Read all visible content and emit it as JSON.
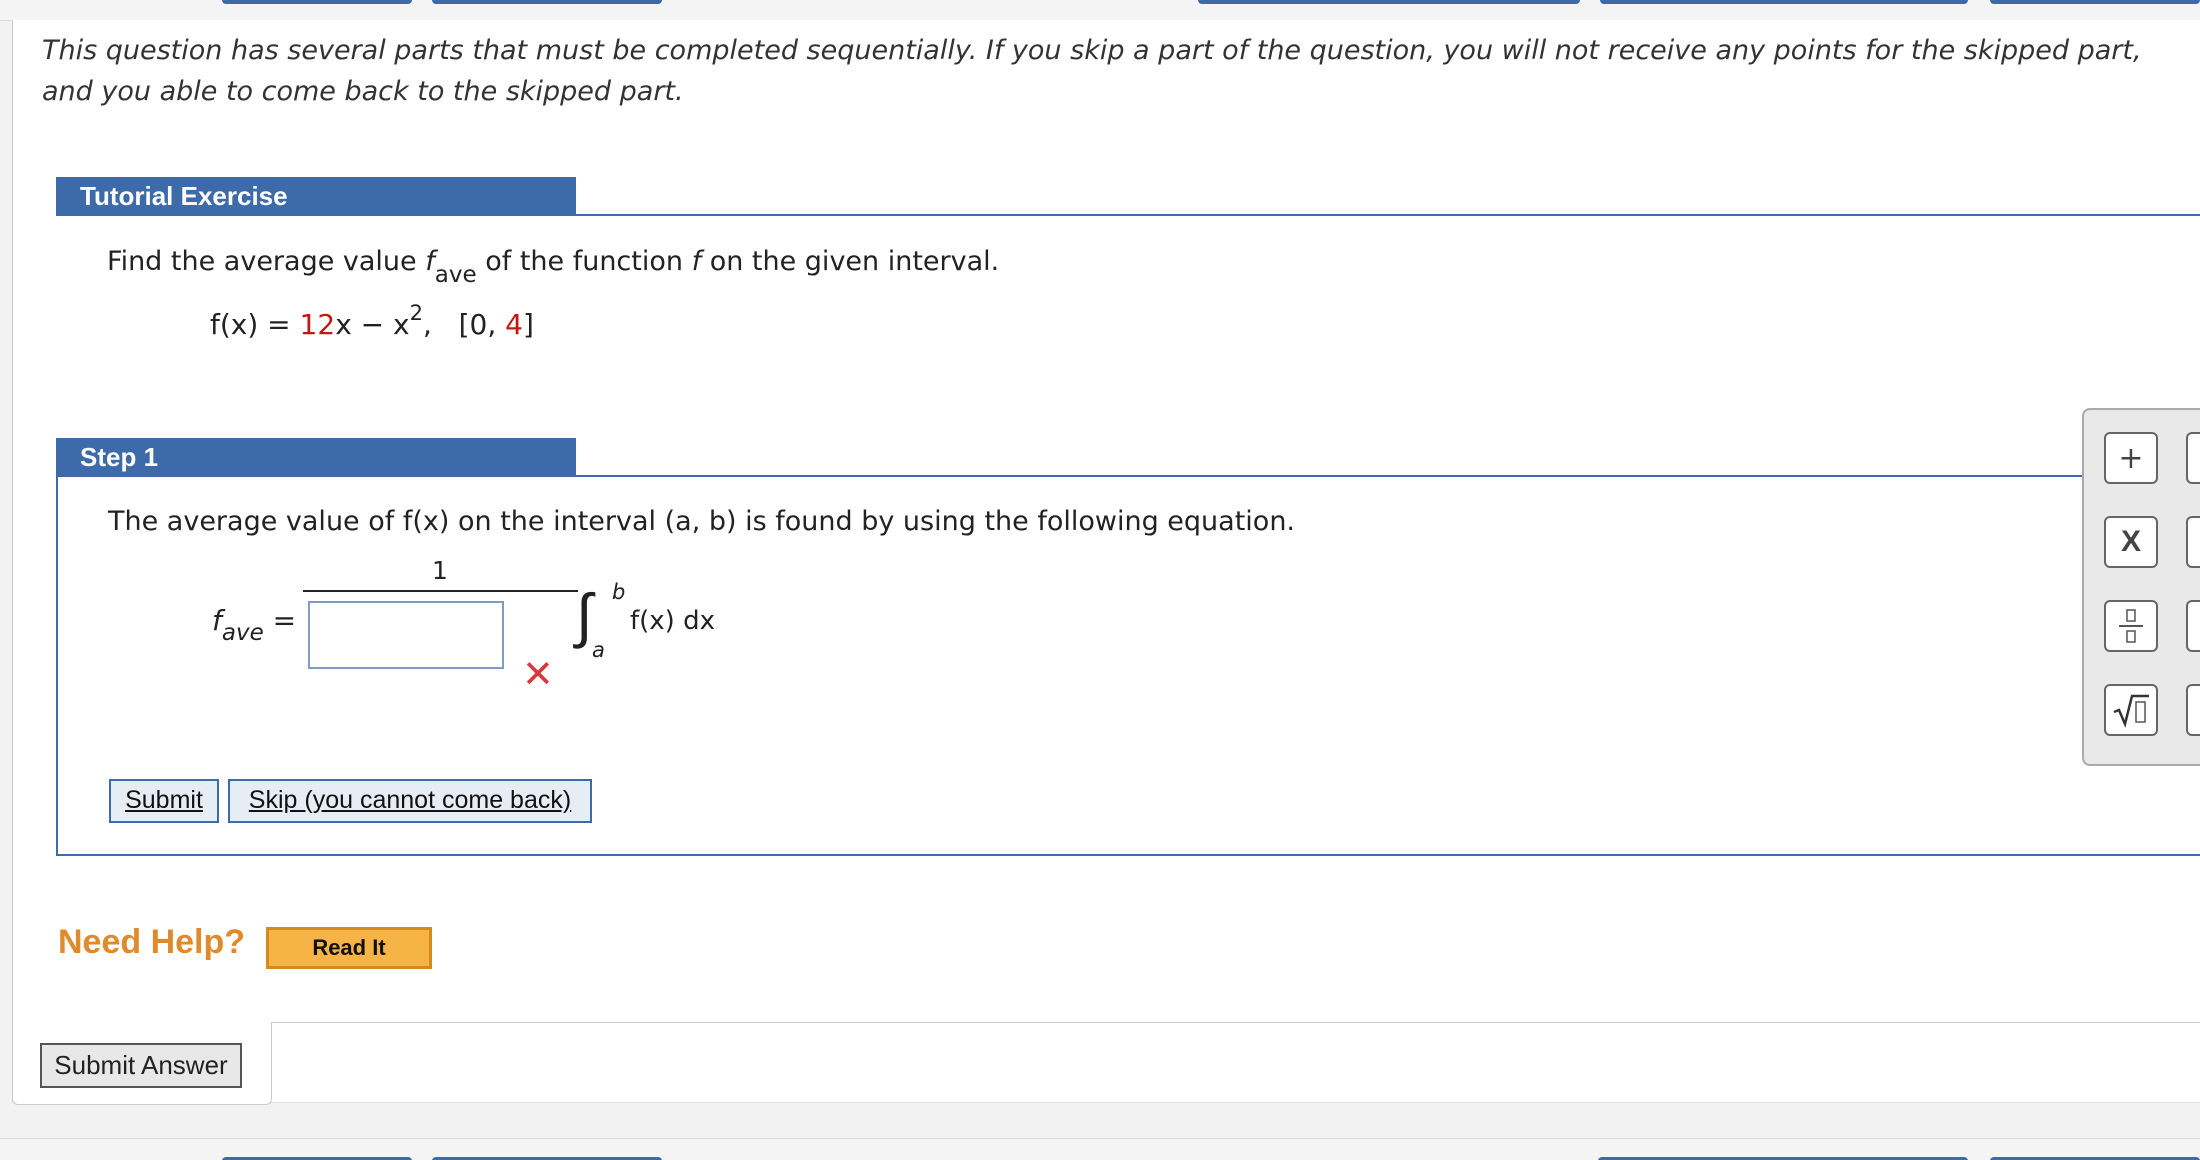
{
  "intro_text": "This question has several parts that must be completed sequentially. If you skip a part of the question, you will not receive any points for the skipped part, and you able to come back to the skipped part.",
  "tutorial": {
    "header": "Tutorial Exercise",
    "prompt_before": "Find the average value ",
    "prompt_f": "f",
    "prompt_sub": "ave",
    "prompt_after": " of the function ",
    "prompt_f2": "f",
    "prompt_end": " on the given interval.",
    "func_lhs": "f(x) = ",
    "func_coef": "12",
    "func_rest": "x − x",
    "func_exp": "2",
    "func_comma": ",",
    "interval_open": "[0, ",
    "interval_end": "4",
    "interval_close": "]"
  },
  "step1": {
    "header": "Step 1",
    "prompt": "The average value of f(x) on the interval (a, b) is found by using the following equation.",
    "numerator": "1",
    "fave_f": "f",
    "fave_sub": "ave",
    "equals": "=",
    "answer_value": "",
    "integral_upper": "b",
    "integral_lower": "a",
    "integrand": "f(x) dx",
    "submit_label": "Submit",
    "skip_label": "Skip (you cannot come back)"
  },
  "help": {
    "label": "Need Help?",
    "read_it": "Read It"
  },
  "submit_answer_label": "Submit Answer",
  "palette": {
    "plus": "+",
    "times": "X",
    "fraction": "▯/▯",
    "sqrt": "√▯"
  },
  "colors": {
    "accent": "#3d6aa8",
    "error": "#d8393c",
    "need_help": "#e08b2b",
    "red_value": "#c0190f"
  }
}
